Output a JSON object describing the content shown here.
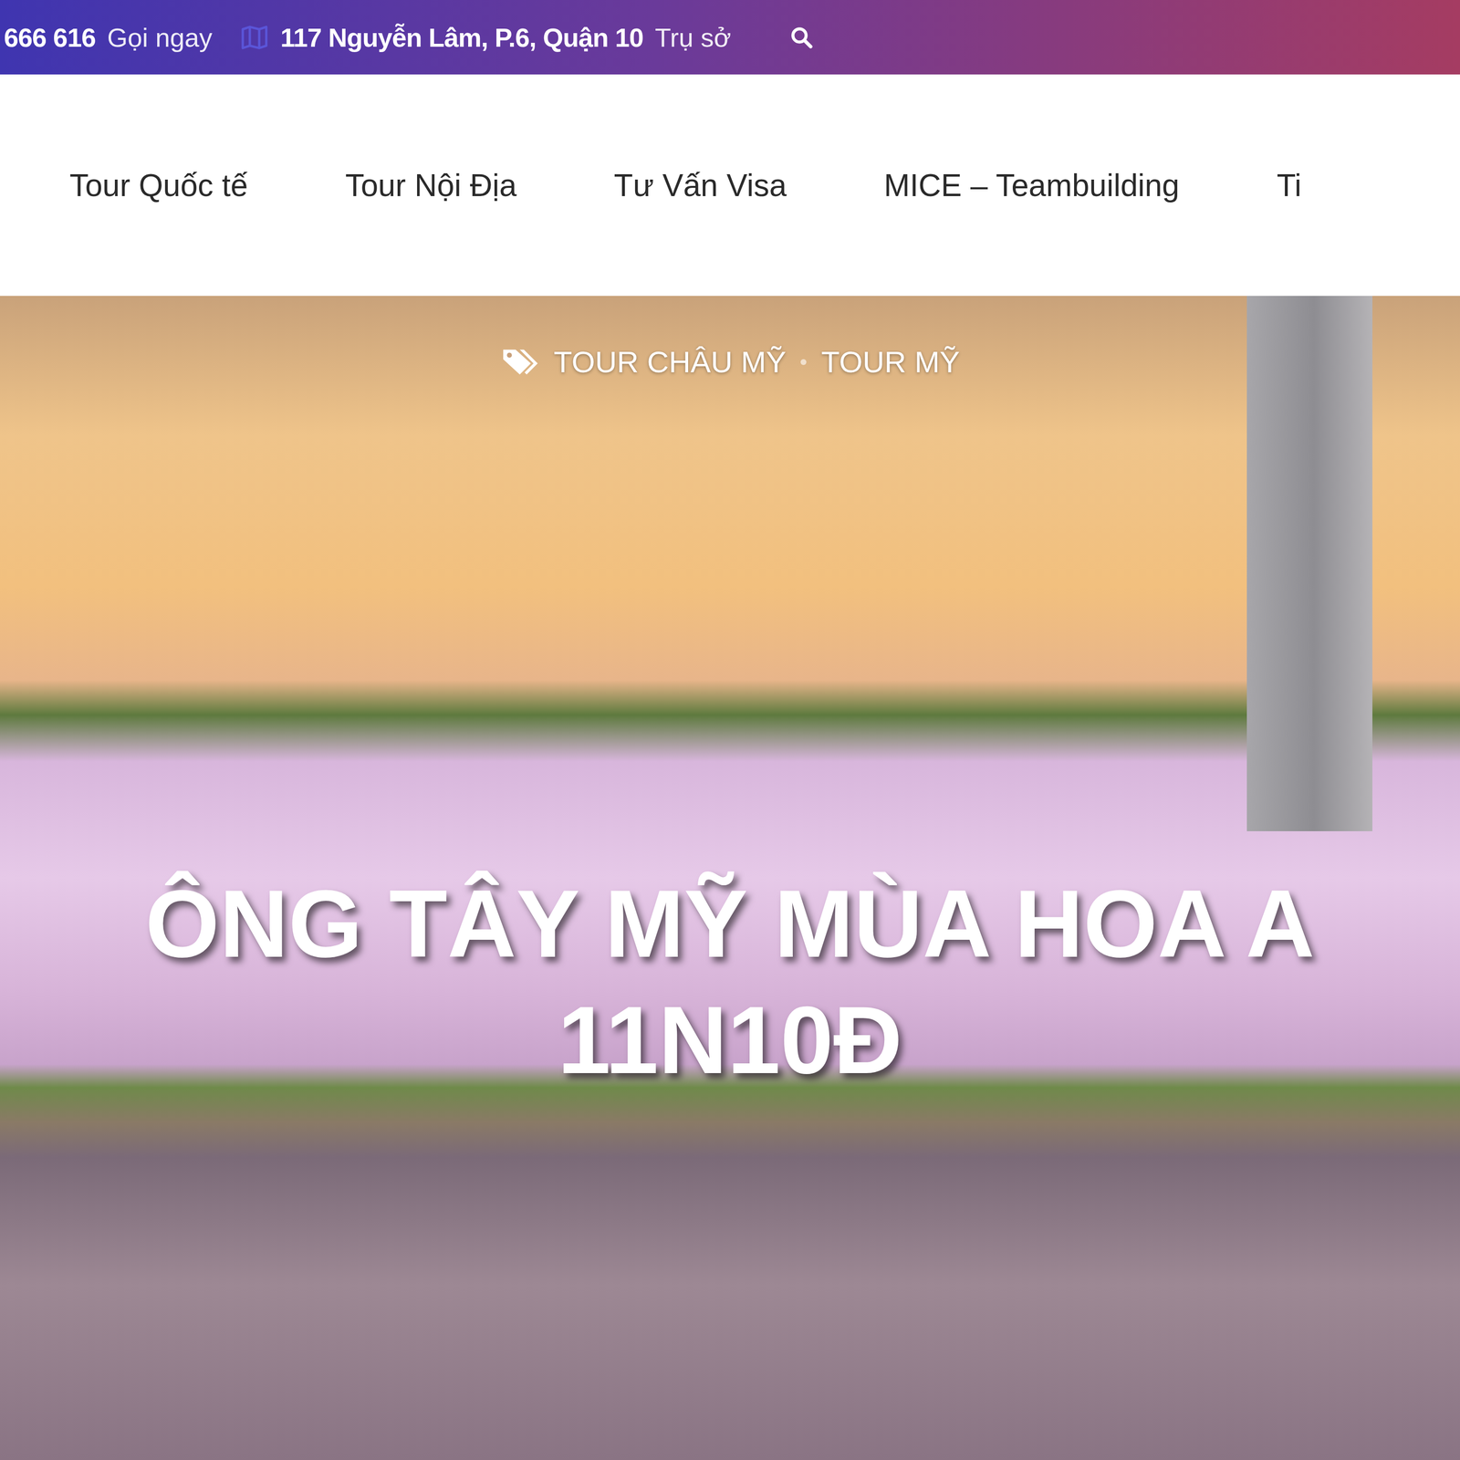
{
  "topbar": {
    "phone": "666 616",
    "call_label": "Gọi ngay",
    "address": "117 Nguyễn Lâm, P.6, Quận 10",
    "address_label": "Trụ sở"
  },
  "nav": {
    "items": [
      "Tour Quốc tế",
      "Tour Nội Địa",
      "Tư Vấn Visa",
      "MICE – Teambuilding",
      "Ti"
    ]
  },
  "hero": {
    "tags": [
      "TOUR CHÂU MỸ",
      "TOUR MỸ"
    ],
    "title_lines": [
      "ÔNG TÂY MỸ MÙA HOA A",
      "11N10Đ"
    ]
  }
}
